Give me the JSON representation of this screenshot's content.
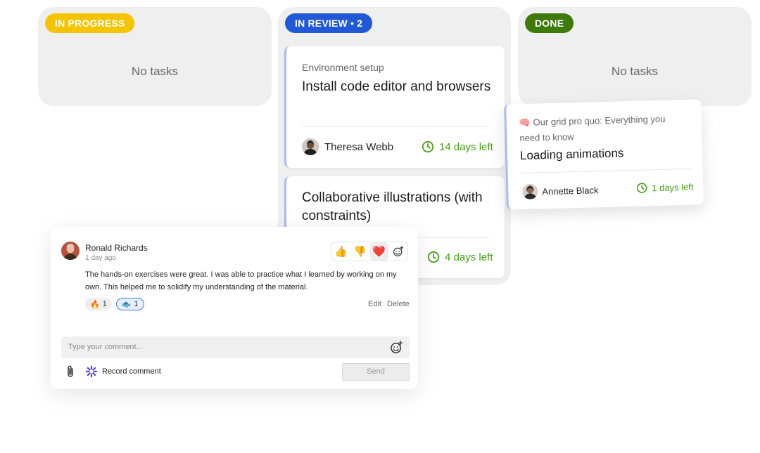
{
  "columns": {
    "in_progress": {
      "label": "IN PROGRESS",
      "color": "#f5c400",
      "empty_text": "No tasks"
    },
    "in_review": {
      "label": "IN REVIEW • 2",
      "color": "#2058d8"
    },
    "done": {
      "label": "DONE",
      "color": "#3d7a0a",
      "empty_text": "No tasks"
    }
  },
  "cards": [
    {
      "category": "Environment setup",
      "title": "Install code editor and browsers",
      "assignee": "Theresa Webb",
      "due": "14 days left"
    },
    {
      "title": "Collaborative illustrations (with constraints)",
      "due": "4 days left"
    }
  ],
  "floating_card": {
    "category": "🧠 Our grid pro quo: Everything you need to know",
    "title": "Loading animations",
    "assignee": "Annette Black",
    "due": "1 days left"
  },
  "comment": {
    "author": "Ronald Richards",
    "time": "1 day ago",
    "body": "The hands-on exercises were great. I was able to practice what I learned by working on my own. This helped me to solidify my understanding of the material.",
    "reaction_buttons": [
      "👍",
      "👎",
      "❤️"
    ],
    "chips": [
      {
        "emoji": "🔥",
        "count": "1"
      },
      {
        "emoji": "🐟",
        "count": "1"
      }
    ],
    "edit_label": "Edit",
    "delete_label": "Delete",
    "input_placeholder": "Type your comment...",
    "record_label": "Record comment",
    "send_label": "Send"
  },
  "accent": {
    "due_green": "#43a012",
    "card_border": "#a8b9f5"
  }
}
